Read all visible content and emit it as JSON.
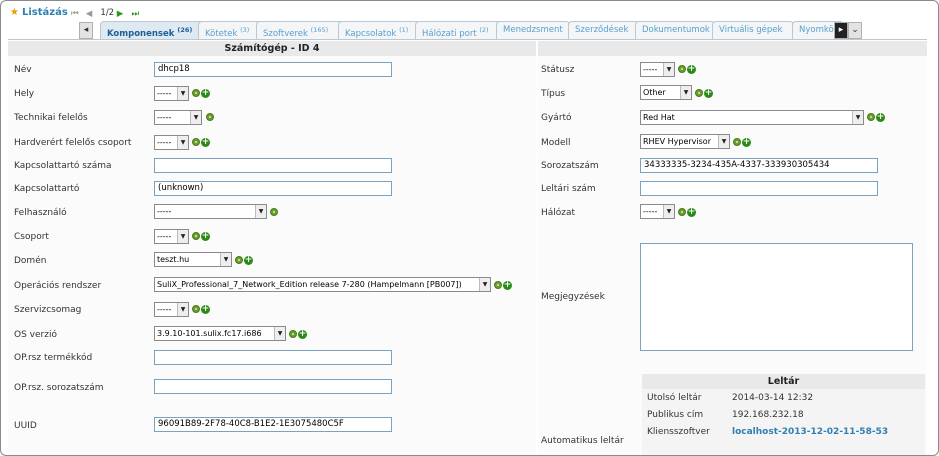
{
  "nav": {
    "listazas": "Listázás",
    "pager": "1/2"
  },
  "tabs": [
    {
      "label": "Komponensek",
      "count": "(26)"
    },
    {
      "label": "Kötetek",
      "count": "(3)"
    },
    {
      "label": "Szoftverek",
      "count": "(165)"
    },
    {
      "label": "Kapcsolatok",
      "count": "(1)"
    },
    {
      "label": "Hálózati port",
      "count": "(2)"
    },
    {
      "label": "Menedzsment",
      "count": ""
    },
    {
      "label": "Szerződések",
      "count": ""
    },
    {
      "label": "Dokumentumok",
      "count": ""
    },
    {
      "label": "Virtuális gépek",
      "count": ""
    },
    {
      "label": "Nyomkö",
      "count": ""
    }
  ],
  "form": {
    "title": "Számítógép - ID 4",
    "left": {
      "nev": {
        "label": "Név",
        "value": "dhcp18"
      },
      "hely": {
        "label": "Hely",
        "value": "-----"
      },
      "tech_felelos": {
        "label": "Technikai felelős",
        "value": "-----"
      },
      "hw_felelos_csoport": {
        "label": "Hardverért felelős csoport",
        "value": "-----"
      },
      "kapcsolattarto_szama": {
        "label": "Kapcsolattartó száma",
        "value": ""
      },
      "kapcsolattarto": {
        "label": "Kapcsolattartó",
        "value": "(unknown)"
      },
      "felhasznalo": {
        "label": "Felhasználó",
        "value": "-----"
      },
      "csoport": {
        "label": "Csoport",
        "value": "-----"
      },
      "domen": {
        "label": "Domén",
        "value": "teszt.hu"
      },
      "os": {
        "label": "Operációs rendszer",
        "value": "SuliX_Professional_7_Network_Edition release 7-280 (Hampelmann [PB007])"
      },
      "szervizcsomag": {
        "label": "Szervizcsomag",
        "value": "-----"
      },
      "os_verzio": {
        "label": "OS verzió",
        "value": "3.9.10-101.sulix.fc17.i686"
      },
      "op_termekkod": {
        "label": "OP.rsz termékkód",
        "value": ""
      },
      "op_sorozatszam": {
        "label": "OP.rsz. sorozatszám",
        "value": ""
      },
      "uuid": {
        "label": "UUID",
        "value": "96091B89-2F78-40C8-B1E2-1E3075480C5F"
      }
    },
    "right": {
      "statusz": {
        "label": "Státusz",
        "value": "-----"
      },
      "tipus": {
        "label": "Típus",
        "value": "Other"
      },
      "gyarto": {
        "label": "Gyártó",
        "value": "Red Hat"
      },
      "modell": {
        "label": "Modell",
        "value": "RHEV Hypervisor"
      },
      "sorozatszam": {
        "label": "Sorozatszám",
        "value": "34333335-3234-435A-4337-333930305434"
      },
      "leltari_szam": {
        "label": "Leltári szám",
        "value": ""
      },
      "halozat": {
        "label": "Hálózat",
        "value": "-----"
      },
      "megjegyzesek": {
        "label": "Megjegyzések",
        "value": ""
      },
      "automatikus_leltar": {
        "label": "Automatikus leltár"
      }
    },
    "leltar": {
      "title": "Leltár",
      "rows": [
        {
          "key": "Utolsó leltár",
          "value": "2014-03-14 12:32"
        },
        {
          "key": "Publikus cím",
          "value": "192.168.232.18"
        },
        {
          "key": "Kliensszoftver",
          "value": "localhost-2013-12-02-11-58-53"
        }
      ]
    }
  }
}
